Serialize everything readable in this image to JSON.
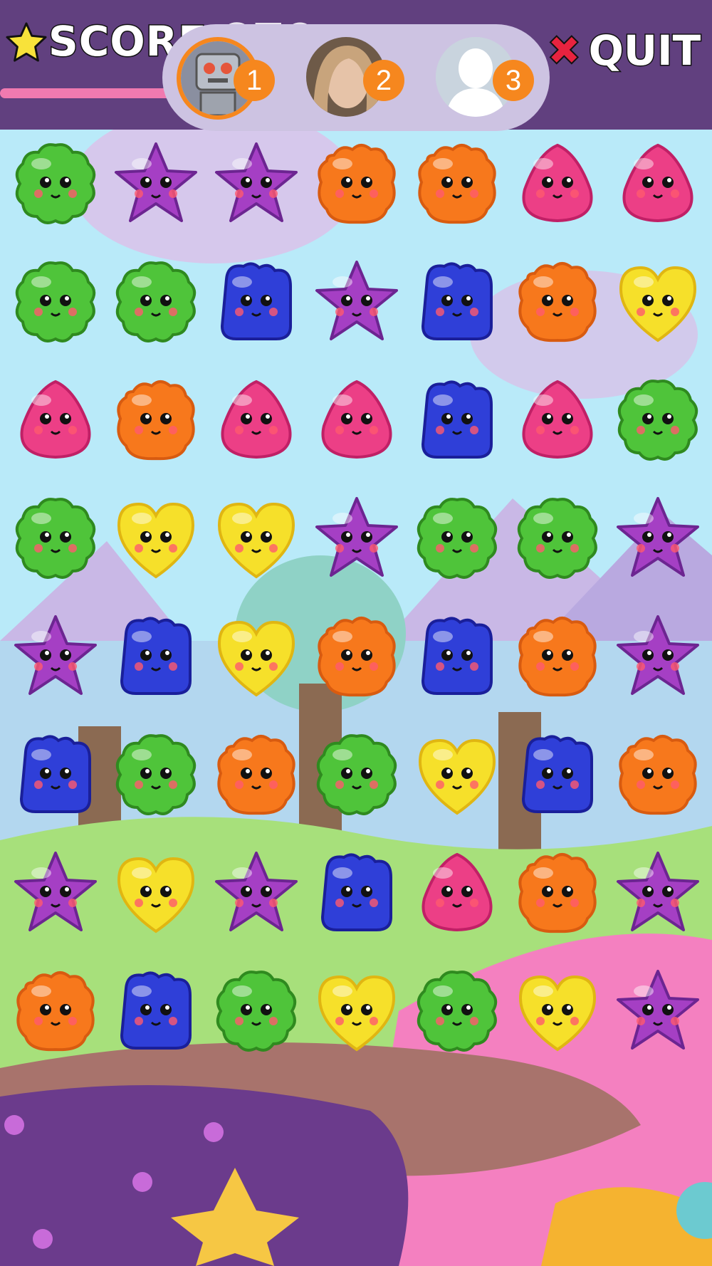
{
  "hud": {
    "score_label": "SCORE",
    "score_value": "270",
    "quit_label": "QUIT",
    "players": [
      {
        "rank": "1",
        "avatar": "robot-avatar"
      },
      {
        "rank": "2",
        "avatar": "photo-avatar"
      },
      {
        "rank": "3",
        "avatar": "silhouette-avatar"
      }
    ]
  },
  "board": {
    "rows": 8,
    "cols": 7,
    "pieces": [
      [
        "green",
        "purple",
        "purple",
        "orange",
        "orange",
        "pink",
        "pink"
      ],
      [
        "green",
        "green",
        "blue",
        "purple",
        "blue",
        "orange",
        "yellow"
      ],
      [
        "pink",
        "orange",
        "pink",
        "pink",
        "blue",
        "pink",
        "green"
      ],
      [
        "green",
        "yellow",
        "yellow",
        "purple",
        "green",
        "green",
        "purple"
      ],
      [
        "purple",
        "blue",
        "yellow",
        "orange",
        "blue",
        "orange",
        "purple"
      ],
      [
        "blue",
        "green",
        "orange",
        "green",
        "yellow",
        "blue",
        "orange"
      ],
      [
        "purple",
        "yellow",
        "purple",
        "blue",
        "pink",
        "orange",
        "purple"
      ],
      [
        "orange",
        "blue",
        "green",
        "yellow",
        "green",
        "yellow",
        "purple"
      ]
    ],
    "piece_shapes": {
      "green": "flower-blob",
      "purple": "star",
      "orange": "fluffy-blob",
      "pink": "drop",
      "blue": "square-blob",
      "yellow": "heart"
    },
    "colors": {
      "green": "#4fc43a",
      "purple": "#a53fc4",
      "orange": "#f7781c",
      "pink": "#ec3f86",
      "blue": "#2f3fd8",
      "yellow": "#f6e02a"
    }
  }
}
